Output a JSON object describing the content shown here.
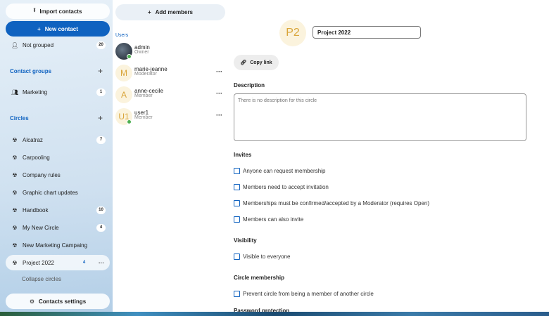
{
  "nav": {
    "import_label": "Import contacts",
    "new_contact_label": "New contact",
    "not_grouped": {
      "label": "Not grouped",
      "count": "20"
    },
    "contact_groups_label": "Contact groups",
    "groups": [
      {
        "label": "Marketing",
        "count": "1"
      }
    ],
    "circles_label": "Circles",
    "circles": [
      {
        "label": "Alcatraz",
        "count": "7"
      },
      {
        "label": "Carpooling",
        "count": ""
      },
      {
        "label": "Company rules",
        "count": ""
      },
      {
        "label": "Graphic chart updates",
        "count": ""
      },
      {
        "label": "Handbook",
        "count": "10"
      },
      {
        "label": "My New Circle",
        "count": "4"
      },
      {
        "label": "New Marketing Campaing",
        "count": ""
      },
      {
        "label": "Project 2022",
        "count": "4"
      }
    ],
    "collapse_label": "Collapse circles",
    "settings_label": "Contacts settings"
  },
  "members": {
    "add_label": "Add members",
    "users_label": "Users",
    "list": [
      {
        "initials": "",
        "name": "admin",
        "role": "Owner"
      },
      {
        "initials": "M",
        "name": "marie-jeanne",
        "role": "Moderator"
      },
      {
        "initials": "A",
        "name": "anne-cecile",
        "role": "Member"
      },
      {
        "initials": "U1",
        "name": "user1",
        "role": "Member"
      }
    ]
  },
  "detail": {
    "avatar_initials": "P2",
    "name_value": "Project 2022",
    "copy_link_label": "Copy link",
    "description_heading": "Description",
    "description_placeholder": "There is no description for this circle",
    "invites_heading": "Invites",
    "invites": [
      "Anyone can request membership",
      "Members need to accept invitation",
      "Memberships must be confirmed/accepted by a Moderator (requires Open)",
      "Members can also invite"
    ],
    "visibility_heading": "Visibility",
    "visibility_option": "Visible to everyone",
    "membership_heading": "Circle membership",
    "membership_option": "Prevent circle from being a member of another circle",
    "password_heading": "Password protection"
  },
  "colors": {
    "accent": "#0f62c0",
    "avatar_bg": "#fbf3dd",
    "avatar_fg": "#d9a53a",
    "online": "#4caf50"
  }
}
